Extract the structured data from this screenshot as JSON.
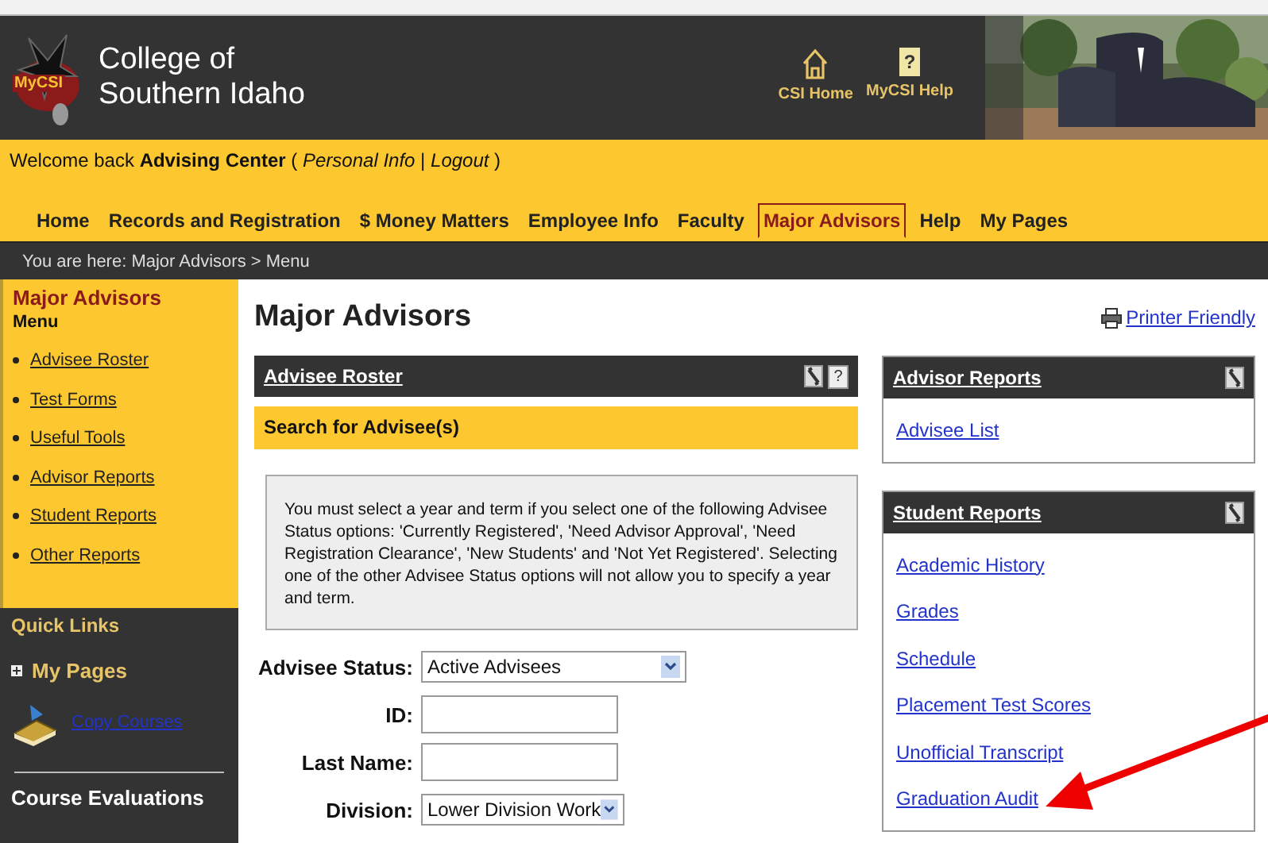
{
  "header": {
    "logo_text": "MyCSI",
    "title_lines": [
      "College of",
      "Southern Idaho"
    ],
    "links": [
      {
        "label": "CSI Home",
        "kind": "home"
      },
      {
        "label": "MyCSI Help",
        "kind": "help",
        "glyph": "?"
      }
    ]
  },
  "welcome": "Welcome back **Advising Center** ( *Personal Info* | *Logout* )",
  "nav": [
    {
      "label": "Home",
      "selected": false
    },
    {
      "label": "Records and Registration",
      "selected": false
    },
    {
      "label": "$ Money Matters",
      "selected": false
    },
    {
      "label": "Employee Info",
      "selected": false
    },
    {
      "label": "Faculty",
      "selected": false
    },
    {
      "label": "Major Advisors",
      "selected": true
    },
    {
      "label": "Help",
      "selected": false
    },
    {
      "label": "My Pages",
      "selected": false
    }
  ],
  "breadcrumb": "You are here:  Major Advisors > Menu",
  "sidebar": {
    "title": "Major Advisors",
    "menu_label": "Menu",
    "items": [
      "Advisee Roster",
      "Test Forms",
      "Useful Tools",
      "Advisor Reports",
      "Student Reports",
      "Other Reports"
    ],
    "quick_links": "Quick Links",
    "my_pages": "My Pages",
    "my_pages_expanded": false,
    "copy_courses": "Copy Courses",
    "course_evaluations": "Course Evaluations"
  },
  "page_title": "Major Advisors",
  "printer_friendly": "Printer Friendly",
  "roster": {
    "title": "Advisee Roster",
    "help_glyph": "?",
    "subtitle": "Search for Advisee(s)",
    "notice": "You must select a year and term if you select one of the following Advisee Status options: 'Currently Registered', 'Need Advisor Approval', 'Need Registration Clearance', 'New Students' and 'Not Yet Registered'. Selecting one of the other Advisee Status options will not allow you to specify a year and term.",
    "fields": [
      {
        "kind": "select",
        "label": "Advisee Status:",
        "value": "Active Advisees"
      },
      {
        "kind": "text",
        "label": "ID:"
      },
      {
        "kind": "text",
        "label": "Last Name:"
      },
      {
        "kind": "select",
        "label": "Division:",
        "value": "Lower Division Work"
      }
    ]
  },
  "panels": [
    {
      "title": "Advisor Reports",
      "links": [
        "Advisee List"
      ]
    },
    {
      "title": "Student Reports",
      "links": [
        "Academic History",
        "Grades",
        "Schedule",
        "Placement Test Scores",
        "Unofficial Transcript",
        "Graduation Audit"
      ]
    }
  ],
  "annotation": {
    "kind": "arrow"
  }
}
